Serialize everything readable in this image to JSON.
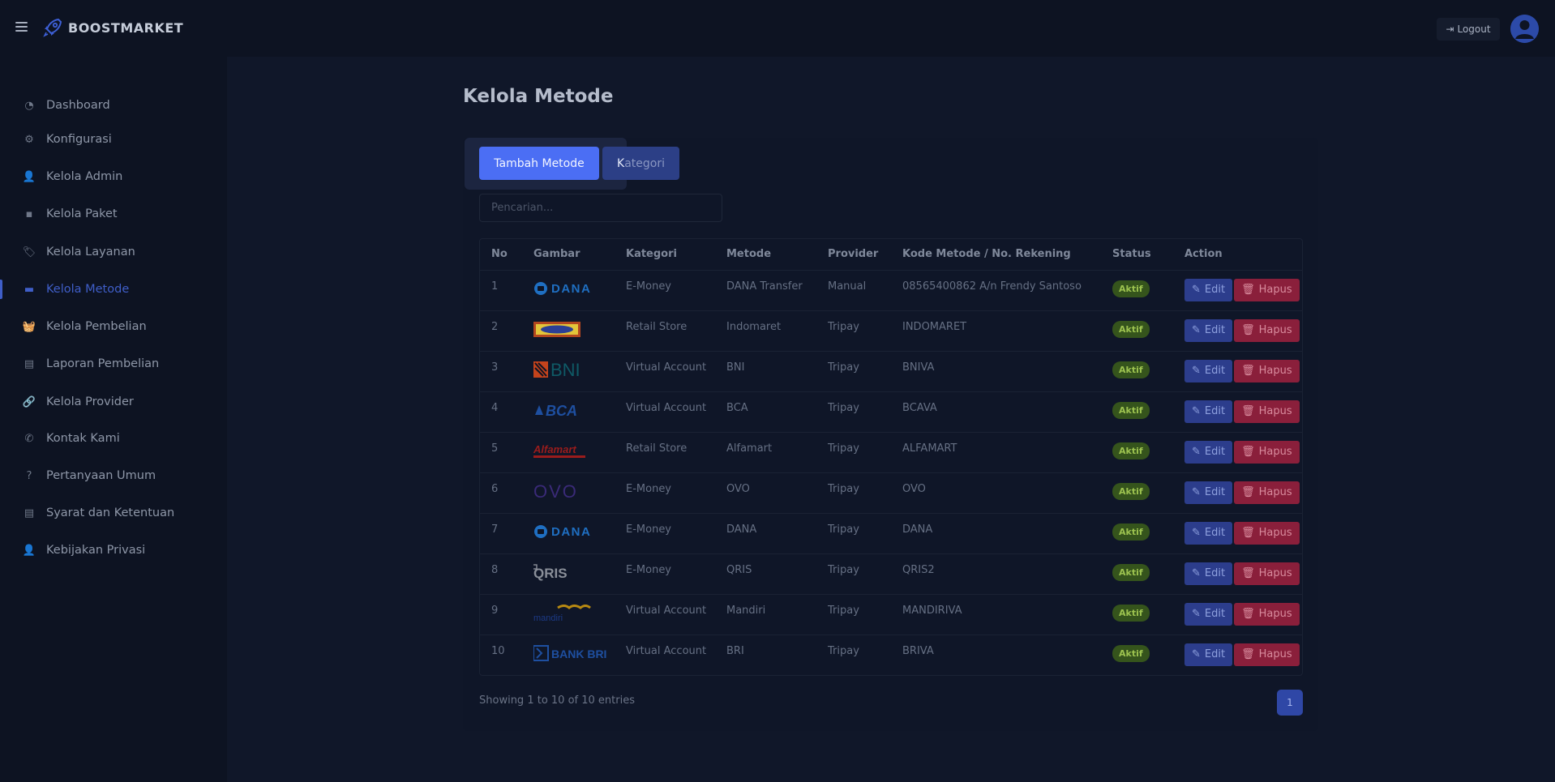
{
  "app": {
    "brand": "BOOSTMARKET",
    "logout_label": "Logout"
  },
  "sidebar": {
    "items": [
      {
        "label": "Dashboard",
        "icon": "speedometer-icon",
        "active": false
      },
      {
        "label": "Konfigurasi",
        "icon": "gears-icon",
        "active": false
      },
      {
        "label": "Kelola Admin",
        "icon": "user-gear-icon",
        "active": false
      },
      {
        "label": "Kelola Paket",
        "icon": "box-icon",
        "active": false
      },
      {
        "label": "Kelola Layanan",
        "icon": "tags-icon",
        "active": false
      },
      {
        "label": "Kelola Metode",
        "icon": "credit-card-icon",
        "active": true
      },
      {
        "label": "Kelola Pembelian",
        "icon": "basket-icon",
        "active": false
      },
      {
        "label": "Laporan Pembelian",
        "icon": "file-icon",
        "active": false
      },
      {
        "label": "Kelola Provider",
        "icon": "link-icon",
        "active": false
      },
      {
        "label": "Kontak Kami",
        "icon": "phone-icon",
        "active": false
      },
      {
        "label": "Pertanyaan Umum",
        "icon": "question-circle-icon",
        "active": false
      },
      {
        "label": "Syarat dan Ketentuan",
        "icon": "file-icon",
        "active": false
      },
      {
        "label": "Kebijakan Privasi",
        "icon": "user-lock-icon",
        "active": false
      }
    ]
  },
  "page": {
    "title": "Kelola Metode",
    "tab_tambah": "Tambah Metode",
    "tab_kategori_first": "K",
    "tab_kategori_rest": "ategori",
    "search_placeholder": "Pencarian...",
    "showing": "Showing 1 to 10 of 10 entries",
    "page_number": "1"
  },
  "table": {
    "headers": [
      "No",
      "Gambar",
      "Kategori",
      "Metode",
      "Provider",
      "Kode Metode / No. Rekening",
      "Status",
      "Action"
    ],
    "edit_label": "Edit",
    "hapus_label": "Hapus",
    "rows": [
      {
        "no": "1",
        "logo": "dana-logo",
        "kategori": "E-Money",
        "metode": "DANA Transfer",
        "provider": "Manual",
        "kode": "08565400862 A/n Frendy Santoso",
        "status": "Aktif"
      },
      {
        "no": "2",
        "logo": "indomaret-logo",
        "kategori": "Retail Store",
        "metode": "Indomaret",
        "provider": "Tripay",
        "kode": "INDOMARET",
        "status": "Aktif"
      },
      {
        "no": "3",
        "logo": "bni-logo",
        "kategori": "Virtual Account",
        "metode": "BNI",
        "provider": "Tripay",
        "kode": "BNIVA",
        "status": "Aktif"
      },
      {
        "no": "4",
        "logo": "bca-logo",
        "kategori": "Virtual Account",
        "metode": "BCA",
        "provider": "Tripay",
        "kode": "BCAVA",
        "status": "Aktif"
      },
      {
        "no": "5",
        "logo": "alfamart-logo",
        "kategori": "Retail Store",
        "metode": "Alfamart",
        "provider": "Tripay",
        "kode": "ALFAMART",
        "status": "Aktif"
      },
      {
        "no": "6",
        "logo": "ovo-logo",
        "kategori": "E-Money",
        "metode": "OVO",
        "provider": "Tripay",
        "kode": "OVO",
        "status": "Aktif"
      },
      {
        "no": "7",
        "logo": "dana-logo",
        "kategori": "E-Money",
        "metode": "DANA",
        "provider": "Tripay",
        "kode": "DANA",
        "status": "Aktif"
      },
      {
        "no": "8",
        "logo": "qris-logo",
        "kategori": "E-Money",
        "metode": "QRIS",
        "provider": "Tripay",
        "kode": "QRIS2",
        "status": "Aktif"
      },
      {
        "no": "9",
        "logo": "mandiri-logo",
        "kategori": "Virtual Account",
        "metode": "Mandiri",
        "provider": "Tripay",
        "kode": "MANDIRIVA",
        "status": "Aktif"
      },
      {
        "no": "10",
        "logo": "bri-logo",
        "kategori": "Virtual Account",
        "metode": "BRI",
        "provider": "Tripay",
        "kode": "BRIVA",
        "status": "Aktif"
      }
    ]
  },
  "colors": {
    "accent": "#4b6ef4",
    "active_nav": "#3f5ec8",
    "badge_green": "#35541c",
    "danger": "#8a1f3b"
  }
}
